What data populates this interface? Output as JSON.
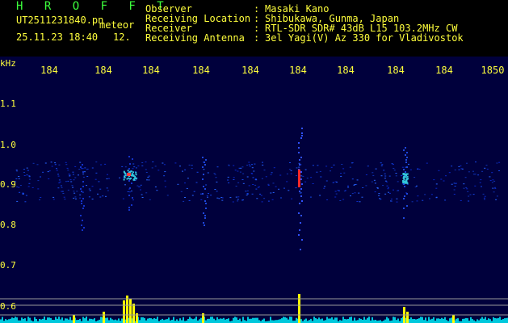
{
  "header": {
    "brand": "H R O F F T",
    "file_name": "UT2511231840.pn",
    "file_tag": "meteor",
    "datetime": "25.11.23 18:40",
    "page_no": "12.",
    "fields": [
      {
        "label": "Observer",
        "value": "Masaki Kano"
      },
      {
        "label": "Receiving Location",
        "value": "Shibukawa, Gunma, Japan"
      },
      {
        "label": "Receiver",
        "value": "RTL-SDR SDR# 43dB L15 103.2MHz CW"
      },
      {
        "label": "Receiving Antenna",
        "value": "3el Yagi(V) Az 330 for Vladivostok"
      }
    ],
    "separator": ":"
  },
  "chart_data": {
    "type": "heatmap",
    "x_unit": "",
    "x_ticks": [
      "184",
      "184",
      "184",
      "184",
      "184",
      "184",
      "184",
      "184",
      "184",
      "1850"
    ],
    "y_unit": "kHz",
    "y_ticks": [
      "1.1",
      "1.0",
      "0.9",
      "0.8",
      "0.7",
      "0.6"
    ],
    "colors": {
      "background": "#00003c",
      "label": "#ffff3c",
      "brand": "#3cff3c",
      "trace": "#ffff00",
      "noise": "#00c8dc"
    }
  }
}
